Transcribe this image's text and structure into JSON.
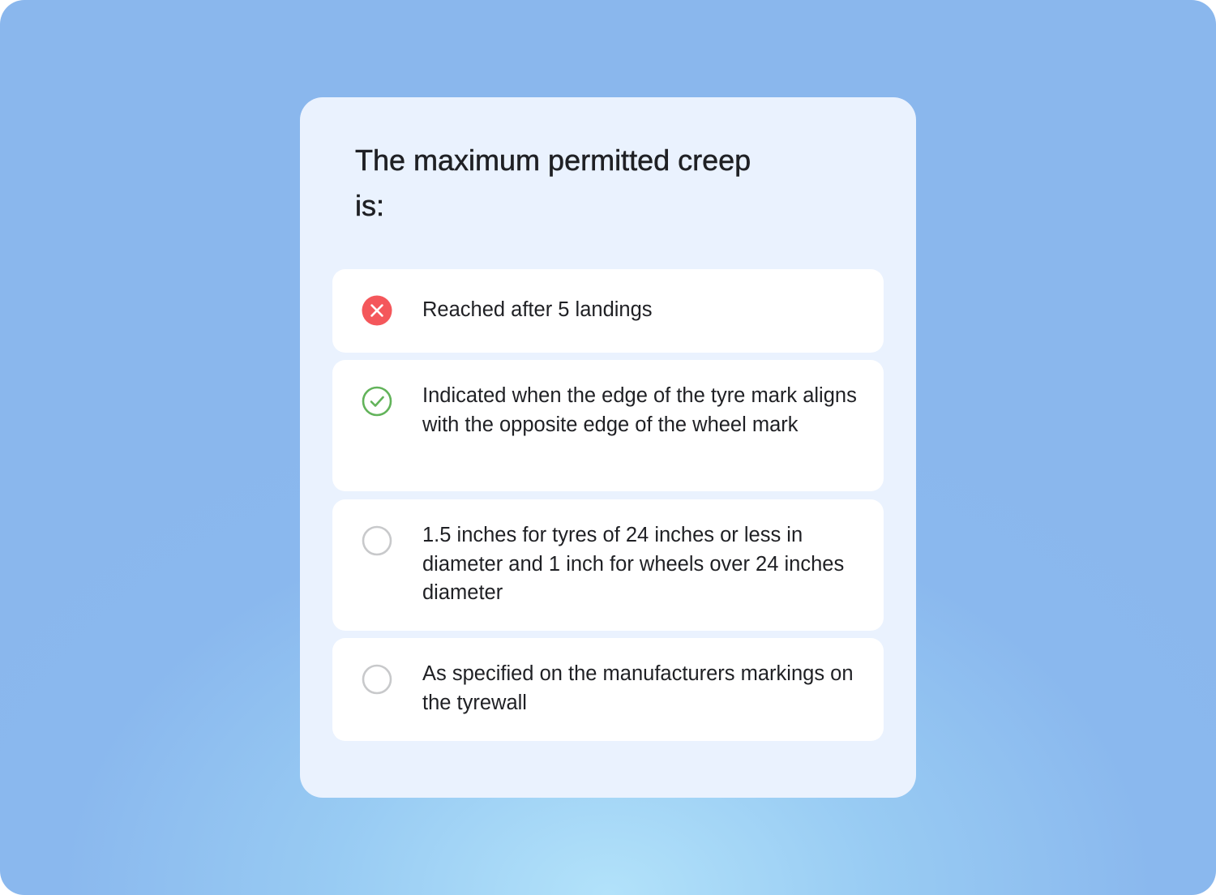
{
  "quiz": {
    "question": "The maximum permitted creep is:",
    "options": [
      {
        "text": "Reached after 5 landings",
        "state": "incorrect",
        "icon": "x-circle-icon"
      },
      {
        "text": "Indicated when the edge of the tyre mark aligns with the opposite edge of the wheel mark",
        "state": "correct",
        "icon": "check-circle-icon"
      },
      {
        "text": "1.5 inches for tyres of 24 inches or less in diameter and 1 inch for wheels over 24 inches diameter",
        "state": "unselected",
        "icon": "radio-empty-icon"
      },
      {
        "text": "As specified on the manufacturers markings on the tyrewall",
        "state": "unselected",
        "icon": "radio-empty-icon"
      }
    ]
  },
  "colors": {
    "incorrect": "#f4575b",
    "correct": "#62b35a",
    "unselected": "#c8c9cb",
    "card_background": "#eaf2fe",
    "page_background": "#8ab7ed"
  }
}
